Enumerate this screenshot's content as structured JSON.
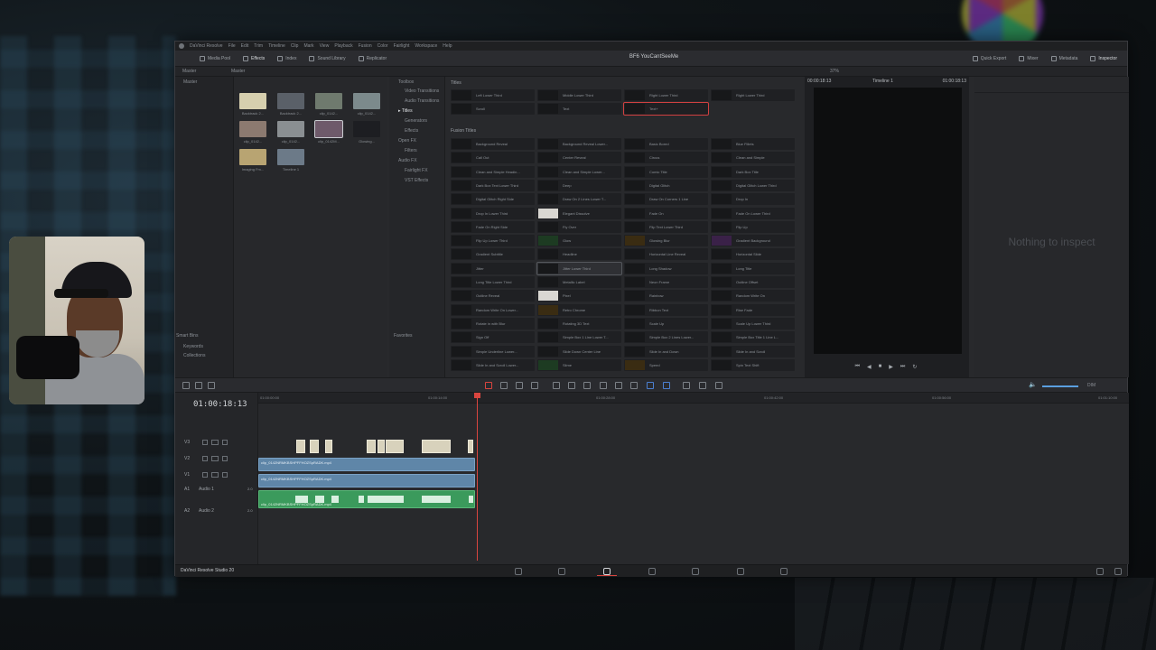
{
  "menubar": {
    "items": [
      "DaVinci Resolve",
      "File",
      "Edit",
      "Trim",
      "Timeline",
      "Clip",
      "Mark",
      "View",
      "Playback",
      "Fusion",
      "Color",
      "Fairlight",
      "Workspace",
      "Help"
    ]
  },
  "toolbar": {
    "media_pool": "Media Pool",
    "effects": "Effects",
    "index": "Index",
    "sound_library": "Sound Library",
    "edit_index": "Replicator",
    "project_title": "BF6 YouCantSeeMe",
    "quick_export": "Quick Export",
    "mixer": "Mixer",
    "metadata": "Metadata",
    "inspector": "Inspector"
  },
  "subbar": {
    "bin": "Master",
    "bin_header": "Master",
    "zoom": "37%",
    "timecode_left": "00:00:18:13",
    "timeline_name": "Timeline 1",
    "timecode_right": "01:00:18:13"
  },
  "media_pool": {
    "tree": [
      "Master"
    ],
    "smart_bins": "Smart Bins",
    "smart_items": [
      "Keywords",
      "Collections"
    ],
    "clips": [
      {
        "label": "Backtrack 2...",
        "color": "#d6cfae"
      },
      {
        "label": "Backtrack 2...",
        "color": "#5a6068"
      },
      {
        "label": "clip_0142...",
        "color": "#6f7a6e"
      },
      {
        "label": "clip_0142...",
        "color": "#7c8a8c"
      },
      {
        "label": "clip_0142...",
        "color": "#8c7a70"
      },
      {
        "label": "clip_0142...",
        "color": "#8a8f92"
      },
      {
        "label": "clip_0142M...",
        "color": "#6e5a6a"
      },
      {
        "label": "Glowing...",
        "color": "#1d1e22"
      },
      {
        "label": "Imaging Fm...",
        "color": "#b8a472"
      },
      {
        "label": "Timeline 1",
        "color": "#6c7a88"
      }
    ]
  },
  "effects_tree": {
    "toolbox": "Toolbox",
    "video_transitions": "Video Transitions",
    "audio_transitions": "Audio Transitions",
    "titles": "Titles",
    "generators": "Generators",
    "effects": "Effects",
    "open_fx": "Open FX",
    "filters": "Filters",
    "audio_fx": "Audio FX",
    "fairlight_fx": "Fairlight FX",
    "vst_effects": "VST Effects",
    "favorites": "Favorites"
  },
  "effects_list": {
    "titles_header": "Titles",
    "titles": [
      "Left Lower Third",
      "Middle Lower Third",
      "Right Lower Third",
      "Right Lower Third",
      "Scroll",
      "Text",
      "Text+"
    ],
    "fusion_header": "Fusion Titles",
    "fusion": [
      "Background Reveal",
      "Background Reveal Lower...",
      "Basic Bored",
      "Blue Fillets",
      "Call Out",
      "Center Reveal",
      "Circus",
      "Clean and Simple",
      "Clean and Simple Headin...",
      "Clean and Simple Lower...",
      "Comic Title",
      "Dark Box Title",
      "Dark Box Text Lower Third",
      "Deep",
      "Digital Glitch",
      "Digital Glitch Lower Third",
      "Digital Glitch Right Side",
      "Draw On 2 Lines Lower T...",
      "Draw On Corners 1 Line",
      "Drop In",
      "Drop In Lower Third",
      "Elegant Dissolve",
      "Fade On",
      "Fade On Lower Third",
      "Fade On Right Side",
      "Fly Over",
      "Flip Text Lower Third",
      "Flip Up",
      "Flip Up Lower Third",
      "Glow",
      "Glowing Blur",
      "Gradient Background",
      "Gradient Subtitle",
      "Headline",
      "Horizontal Line Reveal",
      "Horizontal Slide",
      "Jitter",
      "Jitter Lower Third",
      "Long Shadow",
      "Long Title",
      "Long Title Lower Third",
      "Metallic Label",
      "Neon Frame",
      "Outline Offset",
      "Outline Reveal",
      "Pixel",
      "Rainbow",
      "Random Write On",
      "Random Write On Lower...",
      "Retro Chrome",
      "Ribbon Text",
      "Rise Fade",
      "Rotate in with Blur",
      "Rotating 3D Text",
      "Scale Up",
      "Scale Up Lower Third",
      "Sign Off",
      "Simple Box 1 Line Lower T...",
      "Simple Box 2 Lines Lower...",
      "Simple Box Title 1 Line L...",
      "Simple Underline Lower...",
      "Slide Down Center Line",
      "Slide In and Down",
      "Slide In and Scroll",
      "Slide In and Scroll Lower...",
      "Slime",
      "Speed",
      "Spin Text Shift"
    ]
  },
  "viewer": {
    "inspector_message": "Nothing to inspect"
  },
  "timeline": {
    "timecode": "01:00:18:13",
    "ruler": [
      "01:00:00:00",
      "01:00:14:00",
      "01:00:28:00",
      "01:00:42:00",
      "01:00:56:00",
      "01:01:10:00"
    ],
    "tracks": {
      "v3": "V3",
      "v2": "V2",
      "v1": "V1",
      "a1": "A1",
      "a1_name": "Audio 1",
      "a1_level": "2.0",
      "a2": "A2",
      "a2_name": "Audio 2",
      "a2_level": "2.0"
    },
    "v2_clip": "clip_0142NRMKBSHPFFHOZSpRADK.mp4",
    "v1_clip": "clip_0142NRMKBSHPFFHOZSpRADK.mp4",
    "a1_clip": "clip_0142NRMKBSHPFFHOZSpRADK.mp4",
    "volume_label": "DIM"
  },
  "pages": {
    "brand": "DaVinci Resolve Studio 20"
  },
  "colors": {
    "accent": "#d9453f",
    "video_clip": "#5f86a8",
    "audio_clip": "#3b9a5c"
  }
}
